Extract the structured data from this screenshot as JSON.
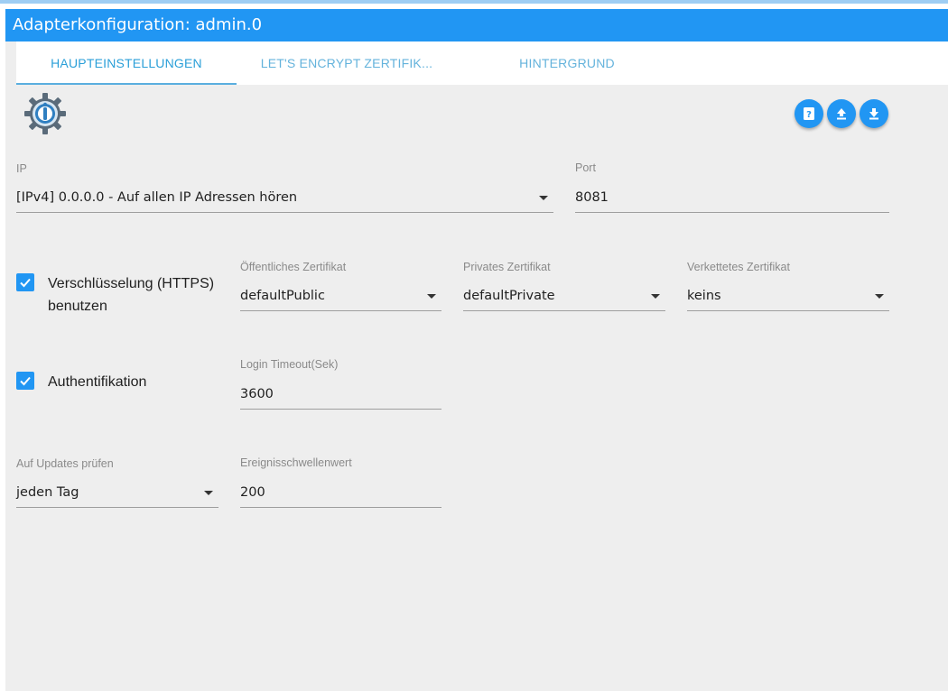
{
  "window": {
    "title": "Adapterkonfiguration: admin.0"
  },
  "tabs": [
    {
      "label": "HAUPTEINSTELLUNGEN",
      "active": true
    },
    {
      "label": "LET'S ENCRYPT ZERTIFIK...",
      "active": false
    },
    {
      "label": "HINTERGRUND",
      "active": false
    }
  ],
  "toolbar": {
    "icons": [
      "help-book-icon",
      "upload-icon",
      "download-icon"
    ],
    "accent": "#2196f3"
  },
  "form": {
    "ip": {
      "label": "IP",
      "value": "[IPv4] 0.0.0.0 - Auf allen IP Adressen hören"
    },
    "port": {
      "label": "Port",
      "value": "8081"
    },
    "https": {
      "label_line1": "Verschlüsselung (HTTPS)",
      "label_line2": "benutzen",
      "checked": true
    },
    "public_cert": {
      "label": "Öffentliches Zertifikat",
      "value": "defaultPublic"
    },
    "private_cert": {
      "label": "Privates Zertifikat",
      "value": "defaultPrivate"
    },
    "chained_cert": {
      "label": "Verkettetes Zertifikat",
      "value": "keins"
    },
    "auth": {
      "label": "Authentifikation",
      "checked": true
    },
    "login_timeout": {
      "label": "Login Timeout(Sek)",
      "value": "3600"
    },
    "updates": {
      "label": "Auf Updates prüfen",
      "value": "jeden Tag"
    },
    "event_threshold": {
      "label": "Ereignisschwellenwert",
      "value": "200"
    }
  }
}
